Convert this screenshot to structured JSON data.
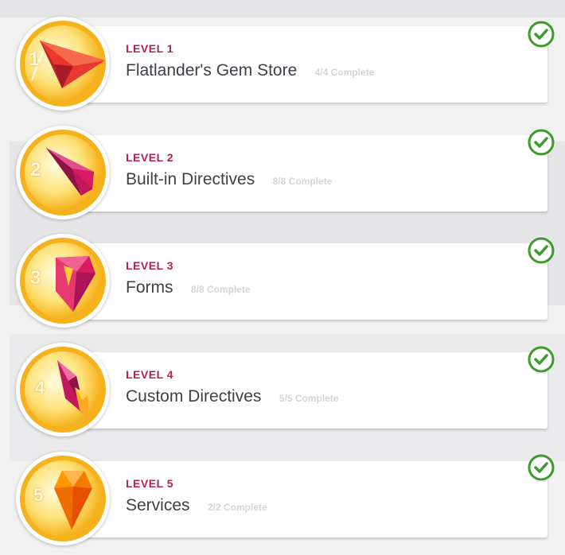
{
  "levels": [
    {
      "label": "LEVEL 1",
      "number": "1",
      "title": "Flatlander's Gem Store",
      "progress": "4/4 Complete",
      "gem": "red-gem-icon"
    },
    {
      "label": "LEVEL 2",
      "number": "2",
      "title": "Built-in Directives",
      "progress": "8/8 Complete",
      "gem": "magenta-gem-icon"
    },
    {
      "label": "LEVEL 3",
      "number": "3",
      "title": "Forms",
      "progress": "8/8 Complete",
      "gem": "pink-gem-icon"
    },
    {
      "label": "LEVEL 4",
      "number": "4",
      "title": "Custom Directives",
      "progress": "5/5 Complete",
      "gem": "crystal-gem-icon"
    },
    {
      "label": "LEVEL 5",
      "number": "5",
      "title": "Services",
      "progress": "2/2 Complete",
      "gem": "orange-gem-icon"
    }
  ],
  "colors": {
    "accent": "#b0234f",
    "badge_gold": "#f6b21c",
    "check_green": "#3d9a2c"
  }
}
